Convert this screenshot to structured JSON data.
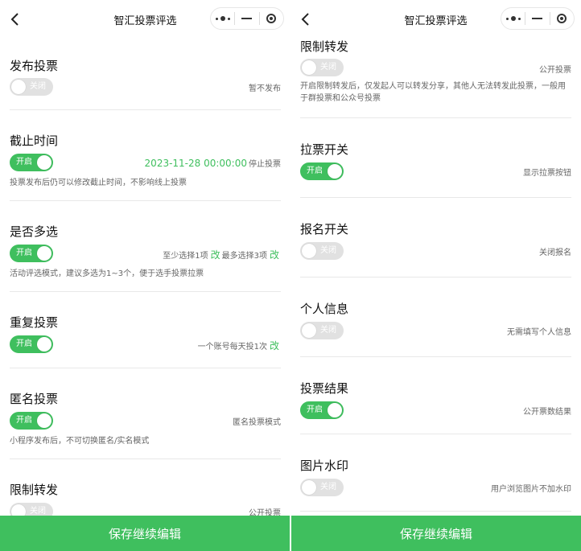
{
  "app": {
    "title": "智汇投票评选"
  },
  "left": {
    "sections": [
      {
        "title": "发布投票",
        "toggle": "关闭",
        "info": "暂不发布"
      },
      {
        "title": "截止时间",
        "toggle": "开启",
        "date": "2023-11-28  00:00:00",
        "info": "停止投票",
        "desc": "投票发布后仍可以修改截止时间，不影响线上投票"
      },
      {
        "title": "是否多选",
        "toggle": "开启",
        "min_text": "至少选择1项",
        "max_text": "最多选择3项",
        "edit": "改",
        "desc": "活动评选模式，建议多选为1~3个，便于选手投票拉票"
      },
      {
        "title": "重复投票",
        "toggle": "开启",
        "info": "一个账号每天投1次",
        "edit": "改"
      },
      {
        "title": "匿名投票",
        "toggle": "开启",
        "info": "匿名投票模式",
        "desc": "小程序发布后，不可切换匿名/实名模式"
      },
      {
        "title": "限制转发",
        "toggle": "关闭",
        "info": "公开投票"
      }
    ]
  },
  "right": {
    "sections": [
      {
        "title": "限制转发",
        "toggle": "关闭",
        "info": "公开投票",
        "desc": "开启限制转发后，仅发起人可以转发分享，其他人无法转发此投票，一般用于群投票和公众号投票"
      },
      {
        "title": "拉票开关",
        "toggle": "开启",
        "info": "显示拉票按钮"
      },
      {
        "title": "报名开关",
        "toggle": "关闭",
        "info": "关闭报名"
      },
      {
        "title": "个人信息",
        "toggle": "关闭",
        "info": "无需填写个人信息"
      },
      {
        "title": "投票结果",
        "toggle": "开启",
        "info": "公开票数结果"
      },
      {
        "title": "图片水印",
        "toggle": "关闭",
        "info": "用户浏览图片不加水印"
      }
    ]
  },
  "save_button": "保存继续编辑",
  "colors": {
    "accent": "#3fbf5e",
    "toggle_off": "#e1e1e1"
  }
}
